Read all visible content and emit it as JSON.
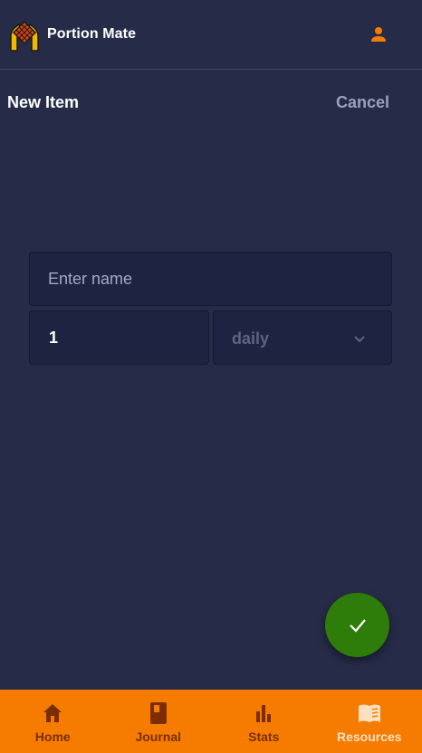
{
  "header": {
    "app_title": "Portion Mate",
    "logo_icon": "portion-mate-logo",
    "profile_icon": "person-icon",
    "accent_color": "#f57c00"
  },
  "subheader": {
    "title": "New Item",
    "cancel_label": "Cancel"
  },
  "form": {
    "name_value": "",
    "name_placeholder": "Enter name",
    "quantity_value": "1",
    "frequency_value": "daily",
    "frequency_icon": "chevron-down-icon"
  },
  "fab": {
    "icon": "check-icon",
    "color": "#2e7d0a"
  },
  "bottom_nav": {
    "background": "#f57c00",
    "items": [
      {
        "label": "Home",
        "icon": "home-icon",
        "active": false
      },
      {
        "label": "Journal",
        "icon": "book-icon",
        "active": false
      },
      {
        "label": "Stats",
        "icon": "bar-chart-icon",
        "active": false
      },
      {
        "label": "Resources",
        "icon": "open-book-icon",
        "active": true
      }
    ]
  }
}
